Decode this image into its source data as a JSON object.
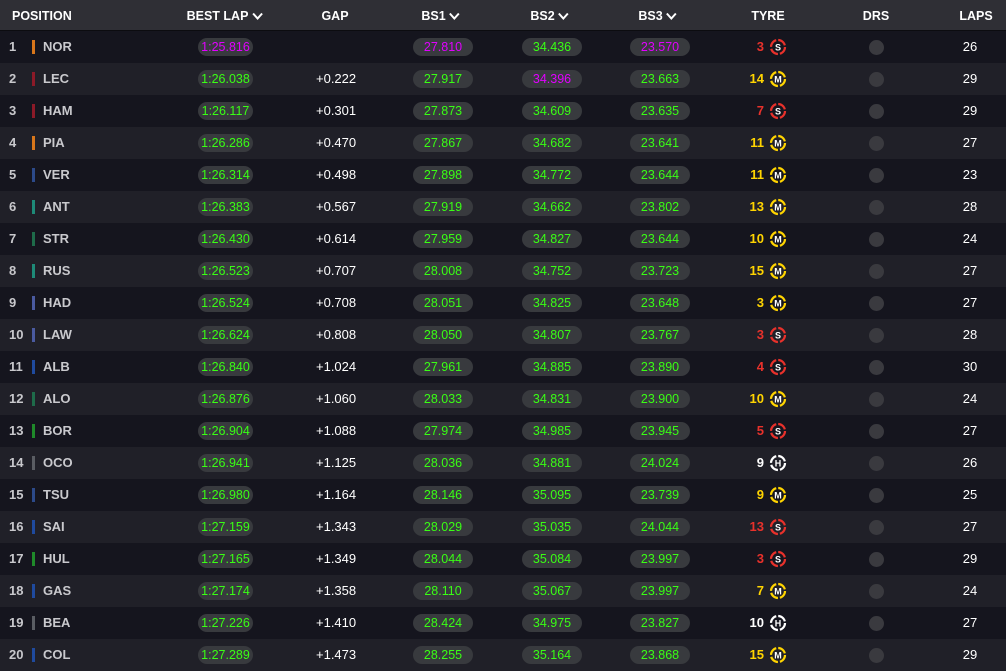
{
  "colors": {
    "header_bg": "#2f2f35",
    "row_odd": "#15151e",
    "row_even": "#202028",
    "pill_bg": "#383a3e",
    "personal_best": "#39ff14",
    "overall_best": "#e100ff",
    "soft": "#e8312b",
    "medium": "#ffd400",
    "hard": "#ffffff"
  },
  "header": {
    "position": "POSITION",
    "best_lap": "BEST LAP",
    "gap": "GAP",
    "bs1": "BS1",
    "bs2": "BS2",
    "bs3": "BS3",
    "tyre": "TYRE",
    "drs": "DRS",
    "laps": "LAPS"
  },
  "rows": [
    {
      "pos": "1",
      "driver": "NOR",
      "team_color": "#d8761b",
      "best_lap": "1:25.816",
      "best_lap_purple": true,
      "gap": "",
      "bs1": "27.810",
      "bs1_purple": true,
      "bs2": "34.436",
      "bs2_purple": false,
      "bs3": "23.570",
      "bs3_purple": true,
      "tyre_laps": "3",
      "tyre": "S",
      "tyre_icon": "soft-tyre-icon",
      "laps": "26"
    },
    {
      "pos": "2",
      "driver": "LEC",
      "team_color": "#8c1a28",
      "best_lap": "1:26.038",
      "best_lap_purple": false,
      "gap": "+0.222",
      "bs1": "27.917",
      "bs1_purple": false,
      "bs2": "34.396",
      "bs2_purple": true,
      "bs3": "23.663",
      "bs3_purple": false,
      "tyre_laps": "14",
      "tyre": "M",
      "tyre_icon": "medium-tyre-icon",
      "laps": "29"
    },
    {
      "pos": "3",
      "driver": "HAM",
      "team_color": "#8c1a28",
      "best_lap": "1:26.117",
      "best_lap_purple": false,
      "gap": "+0.301",
      "bs1": "27.873",
      "bs1_purple": false,
      "bs2": "34.609",
      "bs2_purple": false,
      "bs3": "23.635",
      "bs3_purple": false,
      "tyre_laps": "7",
      "tyre": "S",
      "tyre_icon": "soft-tyre-icon",
      "laps": "29"
    },
    {
      "pos": "4",
      "driver": "PIA",
      "team_color": "#d8761b",
      "best_lap": "1:26.286",
      "best_lap_purple": false,
      "gap": "+0.470",
      "bs1": "27.867",
      "bs1_purple": false,
      "bs2": "34.682",
      "bs2_purple": false,
      "bs3": "23.641",
      "bs3_purple": false,
      "tyre_laps": "11",
      "tyre": "M",
      "tyre_icon": "medium-tyre-icon",
      "laps": "27"
    },
    {
      "pos": "5",
      "driver": "VER",
      "team_color": "#2c4a8a",
      "best_lap": "1:26.314",
      "best_lap_purple": false,
      "gap": "+0.498",
      "bs1": "27.898",
      "bs1_purple": false,
      "bs2": "34.772",
      "bs2_purple": false,
      "bs3": "23.644",
      "bs3_purple": false,
      "tyre_laps": "11",
      "tyre": "M",
      "tyre_icon": "medium-tyre-icon",
      "laps": "23"
    },
    {
      "pos": "6",
      "driver": "ANT",
      "team_color": "#1e8a78",
      "best_lap": "1:26.383",
      "best_lap_purple": false,
      "gap": "+0.567",
      "bs1": "27.919",
      "bs1_purple": false,
      "bs2": "34.662",
      "bs2_purple": false,
      "bs3": "23.802",
      "bs3_purple": false,
      "tyre_laps": "13",
      "tyre": "M",
      "tyre_icon": "medium-tyre-icon",
      "laps": "28"
    },
    {
      "pos": "7",
      "driver": "STR",
      "team_color": "#1e6b4a",
      "best_lap": "1:26.430",
      "best_lap_purple": false,
      "gap": "+0.614",
      "bs1": "27.959",
      "bs1_purple": false,
      "bs2": "34.827",
      "bs2_purple": false,
      "bs3": "23.644",
      "bs3_purple": false,
      "tyre_laps": "10",
      "tyre": "M",
      "tyre_icon": "medium-tyre-icon",
      "laps": "24"
    },
    {
      "pos": "8",
      "driver": "RUS",
      "team_color": "#1e8a78",
      "best_lap": "1:26.523",
      "best_lap_purple": false,
      "gap": "+0.707",
      "bs1": "28.008",
      "bs1_purple": false,
      "bs2": "34.752",
      "bs2_purple": false,
      "bs3": "23.723",
      "bs3_purple": false,
      "tyre_laps": "15",
      "tyre": "M",
      "tyre_icon": "medium-tyre-icon",
      "laps": "27"
    },
    {
      "pos": "9",
      "driver": "HAD",
      "team_color": "#4a5aa0",
      "best_lap": "1:26.524",
      "best_lap_purple": false,
      "gap": "+0.708",
      "bs1": "28.051",
      "bs1_purple": false,
      "bs2": "34.825",
      "bs2_purple": false,
      "bs3": "23.648",
      "bs3_purple": false,
      "tyre_laps": "3",
      "tyre": "M",
      "tyre_icon": "medium-tyre-icon",
      "laps": "27"
    },
    {
      "pos": "10",
      "driver": "LAW",
      "team_color": "#4a5aa0",
      "best_lap": "1:26.624",
      "best_lap_purple": false,
      "gap": "+0.808",
      "bs1": "28.050",
      "bs1_purple": false,
      "bs2": "34.807",
      "bs2_purple": false,
      "bs3": "23.767",
      "bs3_purple": false,
      "tyre_laps": "3",
      "tyre": "S",
      "tyre_icon": "soft-tyre-icon",
      "laps": "28"
    },
    {
      "pos": "11",
      "driver": "ALB",
      "team_color": "#1f4a9e",
      "best_lap": "1:26.840",
      "best_lap_purple": false,
      "gap": "+1.024",
      "bs1": "27.961",
      "bs1_purple": false,
      "bs2": "34.885",
      "bs2_purple": false,
      "bs3": "23.890",
      "bs3_purple": false,
      "tyre_laps": "4",
      "tyre": "S",
      "tyre_icon": "soft-tyre-icon",
      "laps": "30"
    },
    {
      "pos": "12",
      "driver": "ALO",
      "team_color": "#1e6b4a",
      "best_lap": "1:26.876",
      "best_lap_purple": false,
      "gap": "+1.060",
      "bs1": "28.033",
      "bs1_purple": false,
      "bs2": "34.831",
      "bs2_purple": false,
      "bs3": "23.900",
      "bs3_purple": false,
      "tyre_laps": "10",
      "tyre": "M",
      "tyre_icon": "medium-tyre-icon",
      "laps": "24"
    },
    {
      "pos": "13",
      "driver": "BOR",
      "team_color": "#1f8a2a",
      "best_lap": "1:26.904",
      "best_lap_purple": false,
      "gap": "+1.088",
      "bs1": "27.974",
      "bs1_purple": false,
      "bs2": "34.985",
      "bs2_purple": false,
      "bs3": "23.945",
      "bs3_purple": false,
      "tyre_laps": "5",
      "tyre": "S",
      "tyre_icon": "soft-tyre-icon",
      "laps": "27"
    },
    {
      "pos": "14",
      "driver": "OCO",
      "team_color": "#5a5d63",
      "best_lap": "1:26.941",
      "best_lap_purple": false,
      "gap": "+1.125",
      "bs1": "28.036",
      "bs1_purple": false,
      "bs2": "34.881",
      "bs2_purple": false,
      "bs3": "24.024",
      "bs3_purple": false,
      "tyre_laps": "9",
      "tyre": "H",
      "tyre_icon": "hard-tyre-icon",
      "laps": "26"
    },
    {
      "pos": "15",
      "driver": "TSU",
      "team_color": "#2c4a8a",
      "best_lap": "1:26.980",
      "best_lap_purple": false,
      "gap": "+1.164",
      "bs1": "28.146",
      "bs1_purple": false,
      "bs2": "35.095",
      "bs2_purple": false,
      "bs3": "23.739",
      "bs3_purple": false,
      "tyre_laps": "9",
      "tyre": "M",
      "tyre_icon": "medium-tyre-icon",
      "laps": "25"
    },
    {
      "pos": "16",
      "driver": "SAI",
      "team_color": "#1f4a9e",
      "best_lap": "1:27.159",
      "best_lap_purple": false,
      "gap": "+1.343",
      "bs1": "28.029",
      "bs1_purple": false,
      "bs2": "35.035",
      "bs2_purple": false,
      "bs3": "24.044",
      "bs3_purple": false,
      "tyre_laps": "13",
      "tyre": "S",
      "tyre_icon": "soft-tyre-icon",
      "laps": "27"
    },
    {
      "pos": "17",
      "driver": "HUL",
      "team_color": "#1f8a2a",
      "best_lap": "1:27.165",
      "best_lap_purple": false,
      "gap": "+1.349",
      "bs1": "28.044",
      "bs1_purple": false,
      "bs2": "35.084",
      "bs2_purple": false,
      "bs3": "23.997",
      "bs3_purple": false,
      "tyre_laps": "3",
      "tyre": "S",
      "tyre_icon": "soft-tyre-icon",
      "laps": "29"
    },
    {
      "pos": "18",
      "driver": "GAS",
      "team_color": "#1f4a9e",
      "best_lap": "1:27.174",
      "best_lap_purple": false,
      "gap": "+1.358",
      "bs1": "28.110",
      "bs1_purple": false,
      "bs2": "35.067",
      "bs2_purple": false,
      "bs3": "23.997",
      "bs3_purple": false,
      "tyre_laps": "7",
      "tyre": "M",
      "tyre_icon": "medium-tyre-icon",
      "laps": "24"
    },
    {
      "pos": "19",
      "driver": "BEA",
      "team_color": "#5a5d63",
      "best_lap": "1:27.226",
      "best_lap_purple": false,
      "gap": "+1.410",
      "bs1": "28.424",
      "bs1_purple": false,
      "bs2": "34.975",
      "bs2_purple": false,
      "bs3": "23.827",
      "bs3_purple": false,
      "tyre_laps": "10",
      "tyre": "H",
      "tyre_icon": "hard-tyre-icon",
      "laps": "27"
    },
    {
      "pos": "20",
      "driver": "COL",
      "team_color": "#1f4a9e",
      "best_lap": "1:27.289",
      "best_lap_purple": false,
      "gap": "+1.473",
      "bs1": "28.255",
      "bs1_purple": false,
      "bs2": "35.164",
      "bs2_purple": false,
      "bs3": "23.868",
      "bs3_purple": false,
      "tyre_laps": "15",
      "tyre": "M",
      "tyre_icon": "medium-tyre-icon",
      "laps": "29"
    }
  ]
}
